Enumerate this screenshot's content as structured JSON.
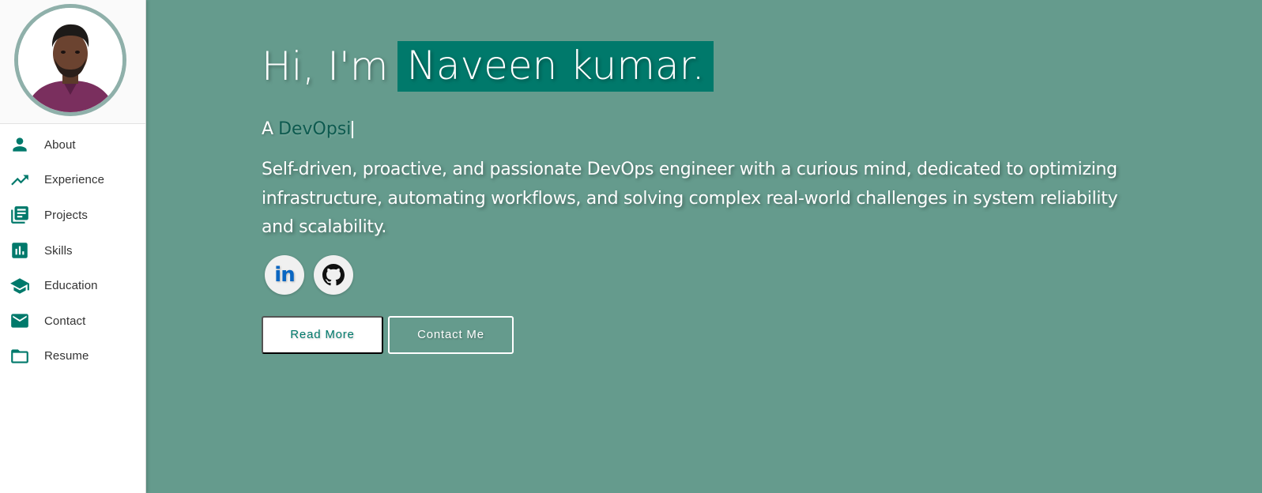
{
  "sidebar": {
    "items": [
      {
        "label": "About",
        "icon": "person-icon"
      },
      {
        "label": "Experience",
        "icon": "trending-up-icon"
      },
      {
        "label": "Projects",
        "icon": "library-books-icon"
      },
      {
        "label": "Skills",
        "icon": "bar-chart-icon"
      },
      {
        "label": "Education",
        "icon": "school-icon"
      },
      {
        "label": "Contact",
        "icon": "email-icon"
      },
      {
        "label": "Resume",
        "icon": "folder-icon"
      }
    ]
  },
  "hero": {
    "greeting_prefix": "Hi, I'm",
    "name": "Naveen kumar.",
    "role_prefix": "A",
    "role_typed": "DevOpsi",
    "description": "Self-driven, proactive, and passionate DevOps engineer with a curious mind, dedicated to optimizing infrastructure, automating workflows, and solving complex real-world challenges in system reliability and scalability.",
    "socials": [
      {
        "label": "in",
        "icon": "linkedin-icon"
      },
      {
        "icon": "github-icon"
      }
    ],
    "buttons": {
      "read_more": "Read More",
      "contact_me": "Contact Me"
    }
  },
  "colors": {
    "accent": "#00796b",
    "hero_background": "#659b8d",
    "avatar_ring": "#8fb0aa",
    "linkedin_blue": "#0a66c2"
  }
}
